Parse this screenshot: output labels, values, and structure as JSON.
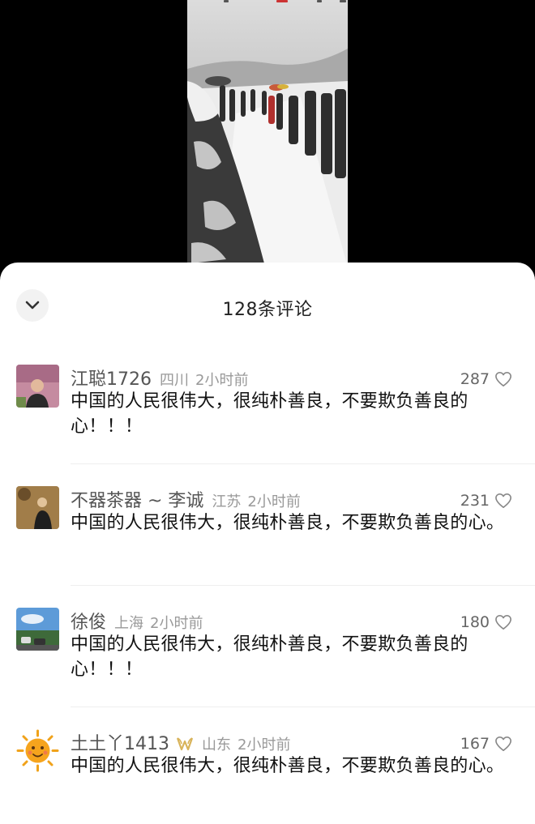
{
  "sheet": {
    "title": "128条评论"
  },
  "comments": [
    {
      "name": "江聪1726",
      "location": "四川",
      "time": "2小时前",
      "likes": "287",
      "text": "中国的人民很伟大，很纯朴善良，不要欺负善良的心！！！"
    },
    {
      "name": "不器茶器 ~ 李诚",
      "location": "江苏",
      "time": "2小时前",
      "likes": "231",
      "text": "中国的人民很伟大，很纯朴善良，不要欺负善良的心。"
    },
    {
      "name": "徐俊",
      "location": "上海",
      "time": "2小时前",
      "likes": "180",
      "text": "中国的人民很伟大，很纯朴善良，不要欺负善良的心！！！"
    },
    {
      "name": "土土丫1413",
      "location": "山东",
      "time": "2小时前",
      "likes": "167",
      "text": "中国的人民很伟大，很纯朴善良，不要欺负善良的心。"
    }
  ]
}
